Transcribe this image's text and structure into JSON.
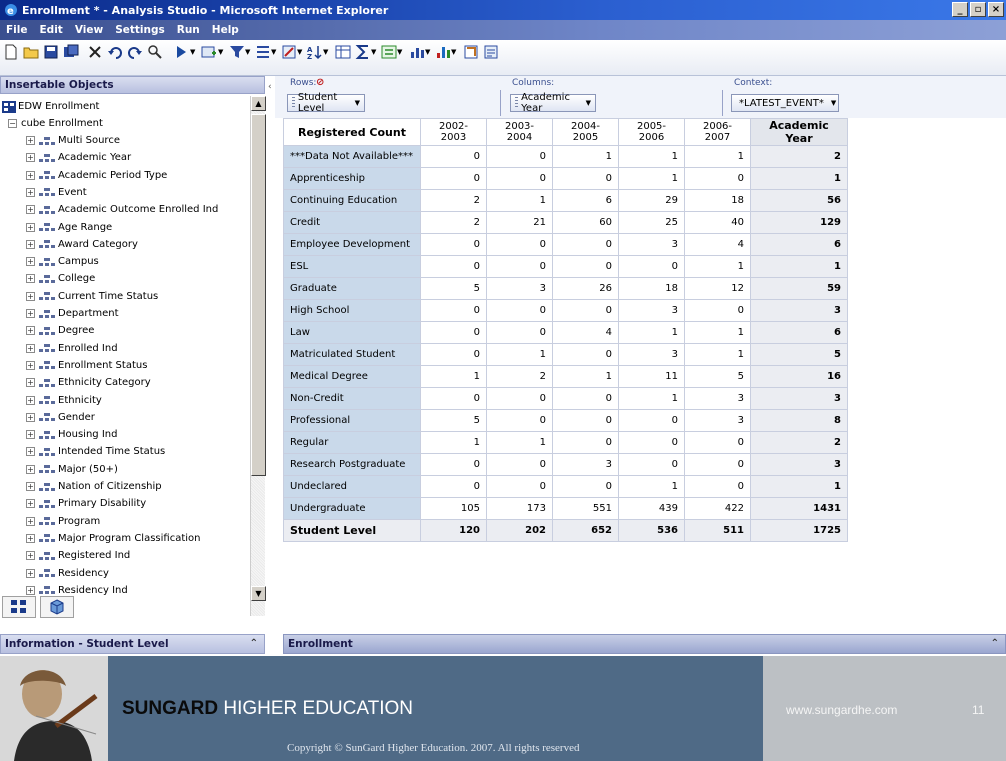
{
  "window": {
    "title": "Enrollment * - Analysis Studio - Microsoft Internet Explorer"
  },
  "menu": [
    "File",
    "Edit",
    "View",
    "Settings",
    "Run",
    "Help"
  ],
  "left_panel": {
    "header": "Insertable Objects",
    "root": "EDW Enrollment",
    "cube": "cube Enrollment",
    "items": [
      "Multi Source",
      "Academic Year",
      "Academic Period Type",
      "Event",
      "Academic Outcome Enrolled Ind",
      "Age Range",
      "Award Category",
      "Campus",
      "College",
      "Current Time Status",
      "Department",
      "Degree",
      "Enrolled Ind",
      "Enrollment Status",
      "Ethnicity Category",
      "Ethnicity",
      "Gender",
      "Housing Ind",
      "Intended Time Status",
      "Major (50+)",
      "Nation of Citizenship",
      "Primary Disability",
      "Program",
      "Major Program Classification",
      "Registered Ind",
      "Residency",
      "Residency Ind"
    ]
  },
  "drop_zones": {
    "rows_label": "Rows:",
    "rows_value": "Student Level",
    "columns_label": "Columns:",
    "columns_value": "Academic Year",
    "context_label": "Context:",
    "context_value": "*LATEST_EVENT*"
  },
  "crosstab": {
    "corner": "Registered Count",
    "columns": [
      "2002-2003",
      "2003-2004",
      "2004-2005",
      "2005-2006",
      "2006-2007"
    ],
    "total_header": "Academic Year",
    "rows": [
      {
        "label": "***Data Not Available***",
        "values": [
          "0",
          "0",
          "1",
          "1",
          "1"
        ],
        "total": "2"
      },
      {
        "label": "Apprenticeship",
        "values": [
          "0",
          "0",
          "0",
          "1",
          "0"
        ],
        "total": "1"
      },
      {
        "label": "Continuing Education",
        "values": [
          "2",
          "1",
          "6",
          "29",
          "18"
        ],
        "total": "56"
      },
      {
        "label": "Credit",
        "values": [
          "2",
          "21",
          "60",
          "25",
          "40"
        ],
        "total": "129"
      },
      {
        "label": "Employee Development",
        "values": [
          "0",
          "0",
          "0",
          "3",
          "4"
        ],
        "total": "6"
      },
      {
        "label": "ESL",
        "values": [
          "0",
          "0",
          "0",
          "0",
          "1"
        ],
        "total": "1"
      },
      {
        "label": "Graduate",
        "values": [
          "5",
          "3",
          "26",
          "18",
          "12"
        ],
        "total": "59"
      },
      {
        "label": "High School",
        "values": [
          "0",
          "0",
          "0",
          "3",
          "0"
        ],
        "total": "3"
      },
      {
        "label": "Law",
        "values": [
          "0",
          "0",
          "4",
          "1",
          "1"
        ],
        "total": "6"
      },
      {
        "label": "Matriculated Student",
        "values": [
          "0",
          "1",
          "0",
          "3",
          "1"
        ],
        "total": "5"
      },
      {
        "label": "Medical Degree",
        "values": [
          "1",
          "2",
          "1",
          "11",
          "5"
        ],
        "total": "16"
      },
      {
        "label": "Non-Credit",
        "values": [
          "0",
          "0",
          "0",
          "1",
          "3"
        ],
        "total": "3"
      },
      {
        "label": "Professional",
        "values": [
          "5",
          "0",
          "0",
          "0",
          "3"
        ],
        "total": "8"
      },
      {
        "label": "Regular",
        "values": [
          "1",
          "1",
          "0",
          "0",
          "0"
        ],
        "total": "2"
      },
      {
        "label": "Research Postgraduate",
        "values": [
          "0",
          "0",
          "3",
          "0",
          "0"
        ],
        "total": "3"
      },
      {
        "label": "Undeclared",
        "values": [
          "0",
          "0",
          "0",
          "1",
          "0"
        ],
        "total": "1"
      },
      {
        "label": "Undergraduate",
        "values": [
          "105",
          "173",
          "551",
          "439",
          "422"
        ],
        "total": "1431"
      }
    ],
    "footer": {
      "label": "Student Level",
      "values": [
        "120",
        "202",
        "652",
        "536",
        "511"
      ],
      "total": "1725"
    }
  },
  "bottom": {
    "info_label": "Information - Student Level",
    "enrollment_label": "Enrollment"
  },
  "banner": {
    "brand_bold": "SUNGARD",
    "brand_rest": "HIGHER EDUCATION",
    "url": "www.sungardhe.com",
    "slide_number": "11",
    "copyright": "Copyright © SunGard Higher Education.  2007.  All rights reserved"
  }
}
